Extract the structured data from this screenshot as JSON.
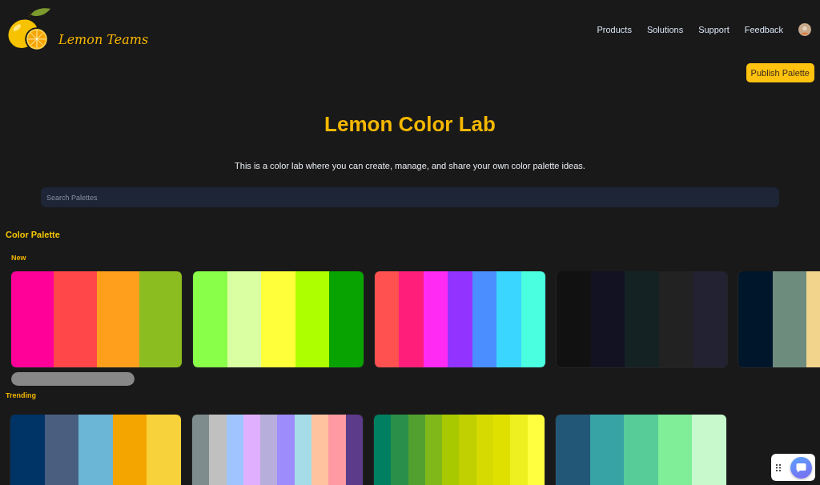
{
  "header": {
    "brand": "Lemon Teams",
    "nav": [
      {
        "label": "Products"
      },
      {
        "label": "Solutions"
      },
      {
        "label": "Support"
      },
      {
        "label": "Feedback"
      }
    ],
    "publish_button": "Publish Palette"
  },
  "hero": {
    "title": "Lemon Color Lab",
    "subtitle": "This is a color lab where you can create, manage, and share your own color palette ideas.",
    "search": {
      "placeholder": "Search Palettes"
    }
  },
  "section": {
    "title": "Color Palette",
    "groups": [
      {
        "title": "New",
        "palettes": [
          {
            "name_loading": true,
            "swatches": [
              {
                "color": "#ff0098"
              },
              {
                "color": "#ff474a"
              },
              {
                "color": "#ff9f1c"
              },
              {
                "color": "#8cbd20"
              }
            ]
          },
          {
            "name_loading": false,
            "swatches": [
              {
                "color": "#8aff4a"
              },
              {
                "color": "#d9ffa2"
              },
              {
                "color": "#ffff3a"
              },
              {
                "color": "#adff00"
              },
              {
                "color": "#08a300"
              }
            ]
          },
          {
            "name_loading": false,
            "swatches": [
              {
                "color": "#ff5150"
              },
              {
                "color": "#ff1f7a"
              },
              {
                "color": "#ff2bf5"
              },
              {
                "color": "#9333ff"
              },
              {
                "color": "#4b8eff"
              },
              {
                "color": "#3ad6ff"
              },
              {
                "color": "#4affe0"
              }
            ]
          },
          {
            "name_loading": false,
            "swatches": [
              {
                "color": "#111111"
              },
              {
                "color": "#121222"
              },
              {
                "color": "#142224"
              },
              {
                "color": "#222222"
              },
              {
                "color": "#222232"
              }
            ]
          },
          {
            "name_loading": false,
            "swatches": [
              {
                "color": "#00172b"
              },
              {
                "color": "#6d8c7e"
              },
              {
                "color": "#f2d48c"
              }
            ]
          }
        ]
      },
      {
        "title": "Trending",
        "palettes": [
          {
            "name_loading": false,
            "swatches": [
              {
                "color": "#003366"
              },
              {
                "color": "#4a5e80"
              },
              {
                "color": "#6bb5d6"
              },
              {
                "color": "#f5a500"
              },
              {
                "color": "#f8d23a"
              }
            ]
          },
          {
            "name_loading": false,
            "swatches": [
              {
                "color": "#7f8c8d"
              },
              {
                "color": "#c0c0c0"
              },
              {
                "color": "#a0c4ff"
              },
              {
                "color": "#e0b0ff"
              },
              {
                "color": "#b8aedb"
              },
              {
                "color": "#9d8cfc"
              },
              {
                "color": "#a6dce8"
              },
              {
                "color": "#ffc3a0"
              },
              {
                "color": "#ff9aa2"
              },
              {
                "color": "#5c3b8a"
              }
            ]
          },
          {
            "name_loading": false,
            "swatches": [
              {
                "color": "#008060"
              },
              {
                "color": "#2a8f48"
              },
              {
                "color": "#52a030"
              },
              {
                "color": "#80b81a"
              },
              {
                "color": "#a8c800"
              },
              {
                "color": "#c0d000"
              },
              {
                "color": "#d6da00"
              },
              {
                "color": "#e0e000"
              },
              {
                "color": "#eef020"
              },
              {
                "color": "#ffff40"
              }
            ]
          },
          {
            "name_loading": false,
            "swatches": [
              {
                "color": "#235777"
              },
              {
                "color": "#38a3a5"
              },
              {
                "color": "#57cc99"
              },
              {
                "color": "#80ed99"
              },
              {
                "color": "#c7f9cc"
              }
            ]
          }
        ]
      }
    ]
  }
}
